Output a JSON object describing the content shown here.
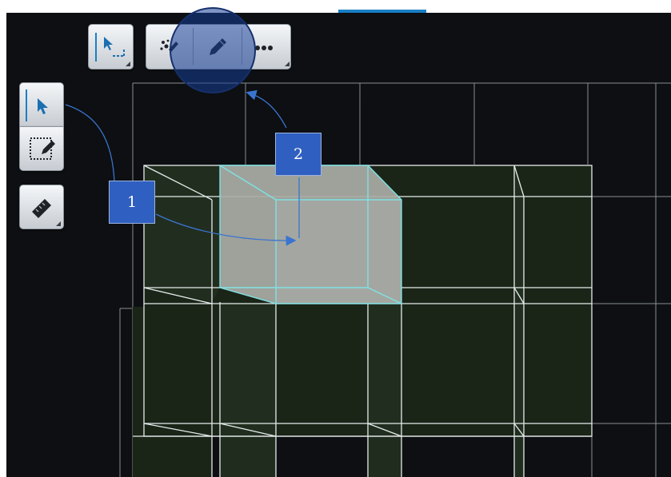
{
  "toolbar": {
    "top_selection_group": {
      "icon": "select-cursor-icon",
      "has_dropdown": true
    },
    "paint_segment": {
      "icon": "paint-splatter-icon"
    },
    "draw_segment": {
      "icon": "pencil-icon"
    },
    "more_segment": {
      "icon": "more-dots-icon",
      "has_dropdown": true
    }
  },
  "side_tools": [
    {
      "name": "select-tool",
      "icon": "cursor-arrow-icon",
      "selected": true
    },
    {
      "name": "marquee-edit-tool",
      "icon": "marquee-pencil-icon"
    },
    {
      "name": "measure-tool",
      "icon": "ruler-icon",
      "has_dropdown": true
    }
  ],
  "callouts": [
    {
      "label": "1"
    },
    {
      "label": "2"
    }
  ],
  "colors": {
    "accent": "#1b7fc4",
    "viewport_bg": "#0d0f12",
    "grid_line": "#e6ecec",
    "cell_fill": "#1a2418",
    "selected_block_fill": "#a9aca6",
    "selected_block_edge": "#7fe2e4",
    "callout_fill": "#2f5fc0",
    "callout_arrow": "#3a74d0",
    "magnifier": "#163e96"
  }
}
